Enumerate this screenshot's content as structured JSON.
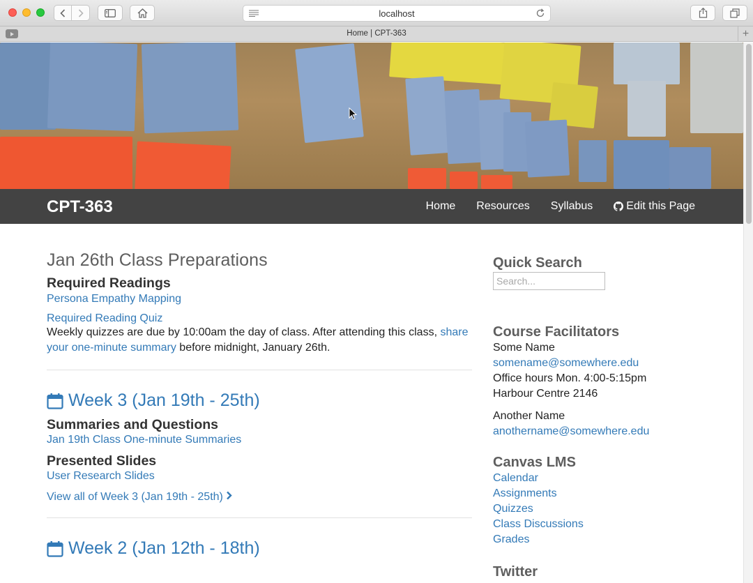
{
  "browser": {
    "url": "localhost",
    "tab_title": "Home | CPT-363"
  },
  "site": {
    "brand": "CPT-363",
    "nav": [
      {
        "label": "Home"
      },
      {
        "label": "Resources"
      },
      {
        "label": "Syllabus"
      },
      {
        "label": "Edit this Page",
        "icon": "github-icon"
      }
    ]
  },
  "main": {
    "prep": {
      "title": "Jan 26th Class Preparations",
      "readings_heading": "Required Readings",
      "reading_link": "Persona Empathy Mapping",
      "quiz_link": "Required Reading Quiz",
      "text_before": "Weekly quizzes are due by 10:00am the day of class. After attending this class, ",
      "summary_link": "share your one-minute summary",
      "text_after": " before midnight, January 26th."
    },
    "week3": {
      "title": "Week 3 (Jan 19th - 25th)",
      "summaries_heading": "Summaries and Questions",
      "summaries_link": "Jan 19th Class One-minute Summaries",
      "slides_heading": "Presented Slides",
      "slides_link": "User Research Slides",
      "view_all": "View all of Week 3 (Jan 19th - 25th)"
    },
    "week2": {
      "title": "Week 2 (Jan 12th - 18th)"
    }
  },
  "sidebar": {
    "search": {
      "heading": "Quick Search",
      "placeholder": "Search..."
    },
    "facilitators": {
      "heading": "Course Facilitators",
      "first": {
        "name": "Some Name",
        "email": "somename@somewhere.edu",
        "hours": "Office hours Mon. 4:00-5:15pm",
        "room": "Harbour Centre 2146"
      },
      "second": {
        "name": "Another Name",
        "email": "anothername@somewhere.edu"
      }
    },
    "canvas": {
      "heading": "Canvas LMS",
      "links": [
        "Calendar",
        "Assignments",
        "Quizzes",
        "Class Discussions",
        "Grades"
      ]
    },
    "twitter": {
      "heading": "Twitter"
    }
  },
  "colors": {
    "link": "#337ab7",
    "navbar": "#434343",
    "heading": "#5e5e5e"
  }
}
